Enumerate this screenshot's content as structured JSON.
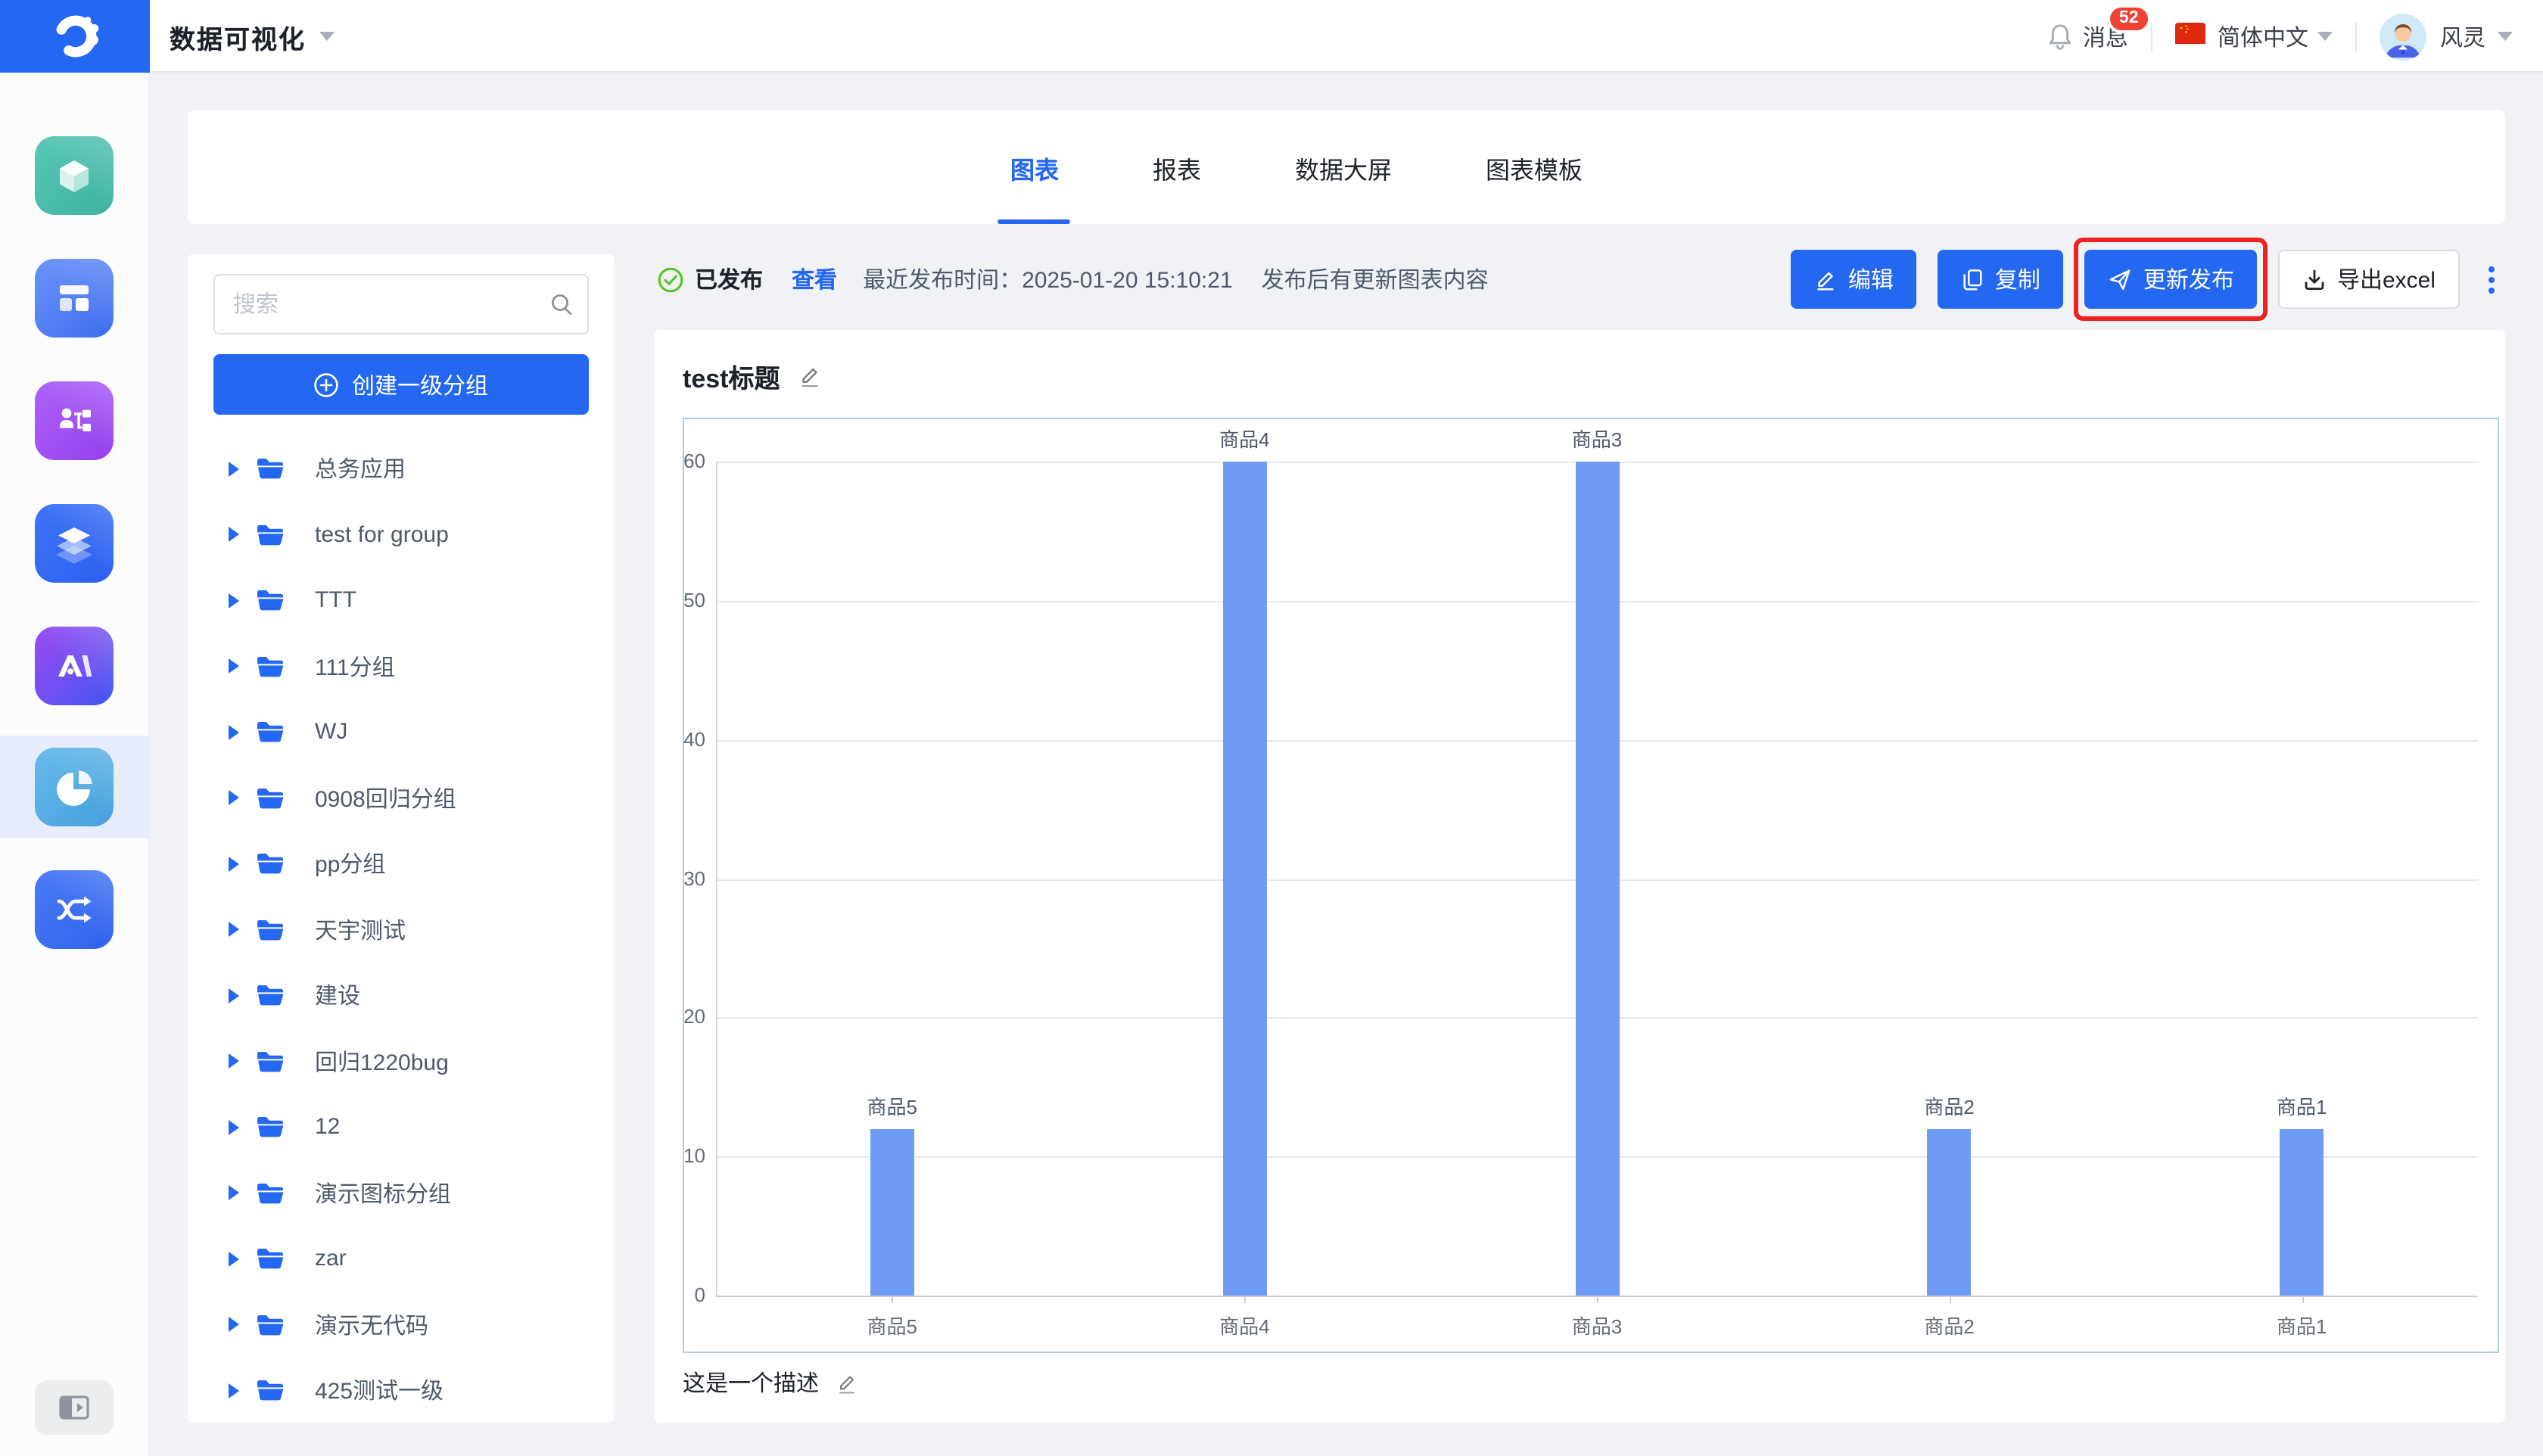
{
  "colors": {
    "brand_blue": "#2468F2",
    "bar_blue": "#6E9BF3",
    "badge_red": "#F04134",
    "highlight_red": "#EF2121",
    "success_green": "#52C41A"
  },
  "top_bar": {
    "app_title": "数据可视化",
    "messages_label": "消息",
    "messages_count": "52",
    "language_label": "简体中文",
    "username": "风灵"
  },
  "rail": {
    "icons": [
      "cube-icon",
      "dashboard-icon",
      "org-chart-icon",
      "layers-icon",
      "ai-icon",
      "pie-chart-icon",
      "shuffle-icon"
    ],
    "active_index": 5
  },
  "tabs": {
    "items": [
      {
        "label": "图表",
        "active": true
      },
      {
        "label": "报表",
        "active": false
      },
      {
        "label": "数据大屏",
        "active": false
      },
      {
        "label": "图表模板",
        "active": false
      }
    ]
  },
  "status_bar": {
    "status_text": "已发布",
    "view_link": "查看",
    "publish_time_text": "最近发布时间：2025-01-20 15:10:21",
    "update_hint": "发布后有更新图表内容",
    "edit_label": "编辑",
    "copy_label": "复制",
    "publish_label": "更新发布",
    "export_label": "导出excel"
  },
  "sidebar_panel": {
    "search_placeholder": "搜索",
    "create_group_label": "创建一级分组",
    "folders": [
      "总务应用",
      "test for group",
      "TTT",
      "111分组",
      "WJ",
      "0908回归分组",
      "pp分组",
      "天宇测试",
      "建设",
      "回归1220bug",
      "12",
      "演示图标分组",
      "zar",
      "演示无代码",
      "425测试一级"
    ]
  },
  "chart_card": {
    "title": "test标题",
    "description": "这是一个描述"
  },
  "chart_data": {
    "type": "bar",
    "categories": [
      "商品5",
      "商品4",
      "商品3",
      "商品2",
      "商品1"
    ],
    "values": [
      12,
      60,
      60,
      12,
      12
    ],
    "title": "test标题",
    "xlabel": "",
    "ylabel": "",
    "ylim": [
      0,
      60
    ],
    "yticks": [
      0,
      10,
      20,
      30,
      40,
      50,
      60
    ],
    "grid": true,
    "legend": "none",
    "bar_label": "category name above each bar",
    "bar_color": "#6E9BF3"
  }
}
